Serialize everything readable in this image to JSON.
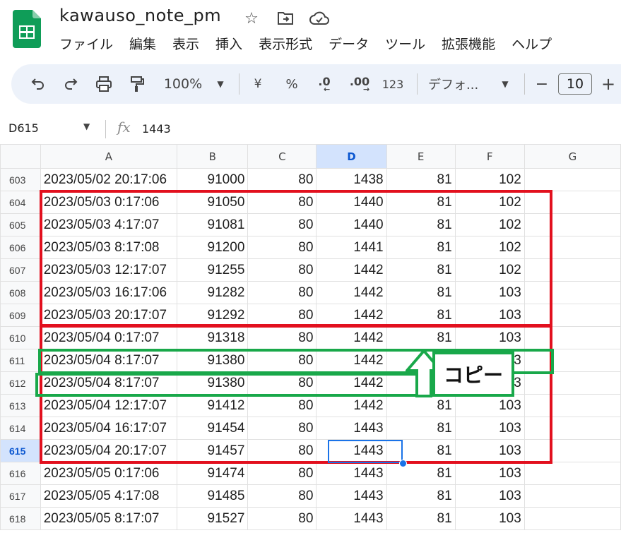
{
  "app": {
    "doc_title": "kawauso_note_pm",
    "menu": [
      "ファイル",
      "編集",
      "表示",
      "挿入",
      "表示形式",
      "データ",
      "ツール",
      "拡張機能",
      "ヘルプ"
    ]
  },
  "toolbar": {
    "zoom": "100%",
    "currency": "¥",
    "percent": "%",
    "decrease_decimal": ".0",
    "increase_decimal": ".00",
    "number_format": "123",
    "font": "デフォ...",
    "font_size": "10",
    "minus": "−",
    "plus": "+"
  },
  "formula_bar": {
    "cell_ref": "D615",
    "value": "1443"
  },
  "columns": [
    "A",
    "B",
    "C",
    "D",
    "E",
    "F",
    "G"
  ],
  "selected_column": "D",
  "selected_row": "615",
  "rows": [
    {
      "n": "603",
      "a": "2023/05/02 20:17:06",
      "b": "91000",
      "c": "80",
      "d": "1438",
      "e": "81",
      "f": "102"
    },
    {
      "n": "604",
      "a": "2023/05/03 0:17:06",
      "b": "91050",
      "c": "80",
      "d": "1440",
      "e": "81",
      "f": "102"
    },
    {
      "n": "605",
      "a": "2023/05/03 4:17:07",
      "b": "91081",
      "c": "80",
      "d": "1440",
      "e": "81",
      "f": "102"
    },
    {
      "n": "606",
      "a": "2023/05/03 8:17:08",
      "b": "91200",
      "c": "80",
      "d": "1441",
      "e": "81",
      "f": "102"
    },
    {
      "n": "607",
      "a": "2023/05/03 12:17:07",
      "b": "91255",
      "c": "80",
      "d": "1442",
      "e": "81",
      "f": "102"
    },
    {
      "n": "608",
      "a": "2023/05/03 16:17:06",
      "b": "91282",
      "c": "80",
      "d": "1442",
      "e": "81",
      "f": "103"
    },
    {
      "n": "609",
      "a": "2023/05/03 20:17:07",
      "b": "91292",
      "c": "80",
      "d": "1442",
      "e": "81",
      "f": "103"
    },
    {
      "n": "610",
      "a": "2023/05/04 0:17:07",
      "b": "91318",
      "c": "80",
      "d": "1442",
      "e": "81",
      "f": "103"
    },
    {
      "n": "611",
      "a": "2023/05/04 8:17:07",
      "b": "91380",
      "c": "80",
      "d": "1442",
      "e": "81",
      "f": "103"
    },
    {
      "n": "612",
      "a": "2023/05/04 8:17:07",
      "b": "91380",
      "c": "80",
      "d": "1442",
      "e": "81",
      "f": "103"
    },
    {
      "n": "613",
      "a": "2023/05/04 12:17:07",
      "b": "91412",
      "c": "80",
      "d": "1442",
      "e": "81",
      "f": "103"
    },
    {
      "n": "614",
      "a": "2023/05/04 16:17:07",
      "b": "91454",
      "c": "80",
      "d": "1443",
      "e": "81",
      "f": "103"
    },
    {
      "n": "615",
      "a": "2023/05/04 20:17:07",
      "b": "91457",
      "c": "80",
      "d": "1443",
      "e": "81",
      "f": "103"
    },
    {
      "n": "616",
      "a": "2023/05/05 0:17:06",
      "b": "91474",
      "c": "80",
      "d": "1443",
      "e": "81",
      "f": "103"
    },
    {
      "n": "617",
      "a": "2023/05/05 4:17:08",
      "b": "91485",
      "c": "80",
      "d": "1443",
      "e": "81",
      "f": "103"
    },
    {
      "n": "618",
      "a": "2023/05/05 8:17:07",
      "b": "91527",
      "c": "80",
      "d": "1443",
      "e": "81",
      "f": "103"
    }
  ],
  "annotation": {
    "copy_label": "コピー"
  },
  "colors": {
    "red_box": "#e2101e",
    "green_box": "#19a84a",
    "selection": "#1a73e8"
  }
}
